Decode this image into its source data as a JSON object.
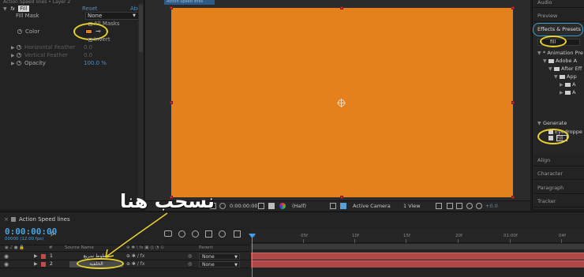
{
  "effect_controls": {
    "header": "Action Speed lines • Layer 2",
    "effect_name": "Fill",
    "reset_label": "Reset",
    "about_label": "Abo",
    "fill_mask_label": "Fill Mask",
    "fill_mask_value": "None",
    "all_masks_label": "All Masks",
    "color_label": "Color",
    "invert_label": "Invert",
    "horizontal_feather_label": "Horizontal Feather",
    "horizontal_feather_value": "0.0",
    "vertical_feather_label": "Vertical Feather",
    "vertical_feather_value": "0.0",
    "opacity_label": "Opacity",
    "opacity_value": "100.0 %",
    "fill_color": "#e4801d"
  },
  "composition": {
    "tab_label": "Action Speed lines",
    "canvas_color": "#e4811c",
    "toolbar": {
      "timecode": "0:00:00:00",
      "resolution": "(Half)",
      "camera": "Active Camera",
      "view": "1 View",
      "exposure": "+0.0"
    }
  },
  "right_panels": {
    "audio": "Audio",
    "preview": "Preview",
    "effects_presets": "Effects & Presets",
    "search_value": "fill",
    "tree": [
      "* Animation Presets",
      "Adobe A",
      "After Eff",
      "App",
      "A",
      "A"
    ],
    "generate_label": "Generate",
    "eyedropper_item": "Eyedroppe",
    "fill_item": "Fill",
    "align": "Align",
    "character": "Character",
    "paragraph": "Paragraph",
    "tracker": "Tracker"
  },
  "timeline": {
    "tab_label": "Action Speed lines",
    "timecode": "0:00:00:00",
    "fps": "00000 (12.00 fps)",
    "search_placeholder": "ρ.",
    "col_number": "#",
    "col_source_name": "Source Name",
    "col_parent": "Parent",
    "layers": [
      {
        "number": "1",
        "name": "خطوط سريع",
        "parent": "None"
      },
      {
        "number": "2",
        "name": "الخلفية",
        "parent": "None"
      }
    ],
    "ruler_ticks": [
      "0f",
      "05f",
      "10f",
      "15f",
      "20f",
      "01:00f",
      "04f"
    ]
  },
  "annotation": {
    "text": "نسحب هنا",
    "color": "#e8d12a"
  }
}
